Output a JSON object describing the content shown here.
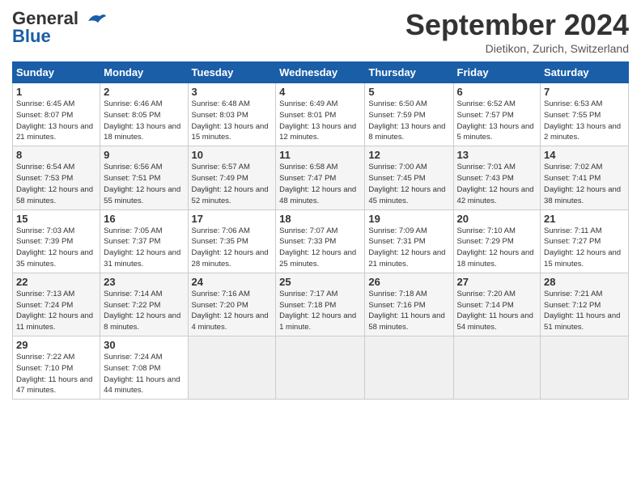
{
  "header": {
    "logo_line1": "General",
    "logo_line2": "Blue",
    "month": "September 2024",
    "location": "Dietikon, Zurich, Switzerland"
  },
  "weekdays": [
    "Sunday",
    "Monday",
    "Tuesday",
    "Wednesday",
    "Thursday",
    "Friday",
    "Saturday"
  ],
  "weeks": [
    [
      {
        "day": "1",
        "sunrise": "Sunrise: 6:45 AM",
        "sunset": "Sunset: 8:07 PM",
        "daylight": "Daylight: 13 hours and 21 minutes."
      },
      {
        "day": "2",
        "sunrise": "Sunrise: 6:46 AM",
        "sunset": "Sunset: 8:05 PM",
        "daylight": "Daylight: 13 hours and 18 minutes."
      },
      {
        "day": "3",
        "sunrise": "Sunrise: 6:48 AM",
        "sunset": "Sunset: 8:03 PM",
        "daylight": "Daylight: 13 hours and 15 minutes."
      },
      {
        "day": "4",
        "sunrise": "Sunrise: 6:49 AM",
        "sunset": "Sunset: 8:01 PM",
        "daylight": "Daylight: 13 hours and 12 minutes."
      },
      {
        "day": "5",
        "sunrise": "Sunrise: 6:50 AM",
        "sunset": "Sunset: 7:59 PM",
        "daylight": "Daylight: 13 hours and 8 minutes."
      },
      {
        "day": "6",
        "sunrise": "Sunrise: 6:52 AM",
        "sunset": "Sunset: 7:57 PM",
        "daylight": "Daylight: 13 hours and 5 minutes."
      },
      {
        "day": "7",
        "sunrise": "Sunrise: 6:53 AM",
        "sunset": "Sunset: 7:55 PM",
        "daylight": "Daylight: 13 hours and 2 minutes."
      }
    ],
    [
      {
        "day": "8",
        "sunrise": "Sunrise: 6:54 AM",
        "sunset": "Sunset: 7:53 PM",
        "daylight": "Daylight: 12 hours and 58 minutes."
      },
      {
        "day": "9",
        "sunrise": "Sunrise: 6:56 AM",
        "sunset": "Sunset: 7:51 PM",
        "daylight": "Daylight: 12 hours and 55 minutes."
      },
      {
        "day": "10",
        "sunrise": "Sunrise: 6:57 AM",
        "sunset": "Sunset: 7:49 PM",
        "daylight": "Daylight: 12 hours and 52 minutes."
      },
      {
        "day": "11",
        "sunrise": "Sunrise: 6:58 AM",
        "sunset": "Sunset: 7:47 PM",
        "daylight": "Daylight: 12 hours and 48 minutes."
      },
      {
        "day": "12",
        "sunrise": "Sunrise: 7:00 AM",
        "sunset": "Sunset: 7:45 PM",
        "daylight": "Daylight: 12 hours and 45 minutes."
      },
      {
        "day": "13",
        "sunrise": "Sunrise: 7:01 AM",
        "sunset": "Sunset: 7:43 PM",
        "daylight": "Daylight: 12 hours and 42 minutes."
      },
      {
        "day": "14",
        "sunrise": "Sunrise: 7:02 AM",
        "sunset": "Sunset: 7:41 PM",
        "daylight": "Daylight: 12 hours and 38 minutes."
      }
    ],
    [
      {
        "day": "15",
        "sunrise": "Sunrise: 7:03 AM",
        "sunset": "Sunset: 7:39 PM",
        "daylight": "Daylight: 12 hours and 35 minutes."
      },
      {
        "day": "16",
        "sunrise": "Sunrise: 7:05 AM",
        "sunset": "Sunset: 7:37 PM",
        "daylight": "Daylight: 12 hours and 31 minutes."
      },
      {
        "day": "17",
        "sunrise": "Sunrise: 7:06 AM",
        "sunset": "Sunset: 7:35 PM",
        "daylight": "Daylight: 12 hours and 28 minutes."
      },
      {
        "day": "18",
        "sunrise": "Sunrise: 7:07 AM",
        "sunset": "Sunset: 7:33 PM",
        "daylight": "Daylight: 12 hours and 25 minutes."
      },
      {
        "day": "19",
        "sunrise": "Sunrise: 7:09 AM",
        "sunset": "Sunset: 7:31 PM",
        "daylight": "Daylight: 12 hours and 21 minutes."
      },
      {
        "day": "20",
        "sunrise": "Sunrise: 7:10 AM",
        "sunset": "Sunset: 7:29 PM",
        "daylight": "Daylight: 12 hours and 18 minutes."
      },
      {
        "day": "21",
        "sunrise": "Sunrise: 7:11 AM",
        "sunset": "Sunset: 7:27 PM",
        "daylight": "Daylight: 12 hours and 15 minutes."
      }
    ],
    [
      {
        "day": "22",
        "sunrise": "Sunrise: 7:13 AM",
        "sunset": "Sunset: 7:24 PM",
        "daylight": "Daylight: 12 hours and 11 minutes."
      },
      {
        "day": "23",
        "sunrise": "Sunrise: 7:14 AM",
        "sunset": "Sunset: 7:22 PM",
        "daylight": "Daylight: 12 hours and 8 minutes."
      },
      {
        "day": "24",
        "sunrise": "Sunrise: 7:16 AM",
        "sunset": "Sunset: 7:20 PM",
        "daylight": "Daylight: 12 hours and 4 minutes."
      },
      {
        "day": "25",
        "sunrise": "Sunrise: 7:17 AM",
        "sunset": "Sunset: 7:18 PM",
        "daylight": "Daylight: 12 hours and 1 minute."
      },
      {
        "day": "26",
        "sunrise": "Sunrise: 7:18 AM",
        "sunset": "Sunset: 7:16 PM",
        "daylight": "Daylight: 11 hours and 58 minutes."
      },
      {
        "day": "27",
        "sunrise": "Sunrise: 7:20 AM",
        "sunset": "Sunset: 7:14 PM",
        "daylight": "Daylight: 11 hours and 54 minutes."
      },
      {
        "day": "28",
        "sunrise": "Sunrise: 7:21 AM",
        "sunset": "Sunset: 7:12 PM",
        "daylight": "Daylight: 11 hours and 51 minutes."
      }
    ],
    [
      {
        "day": "29",
        "sunrise": "Sunrise: 7:22 AM",
        "sunset": "Sunset: 7:10 PM",
        "daylight": "Daylight: 11 hours and 47 minutes."
      },
      {
        "day": "30",
        "sunrise": "Sunrise: 7:24 AM",
        "sunset": "Sunset: 7:08 PM",
        "daylight": "Daylight: 11 hours and 44 minutes."
      },
      null,
      null,
      null,
      null,
      null
    ]
  ]
}
